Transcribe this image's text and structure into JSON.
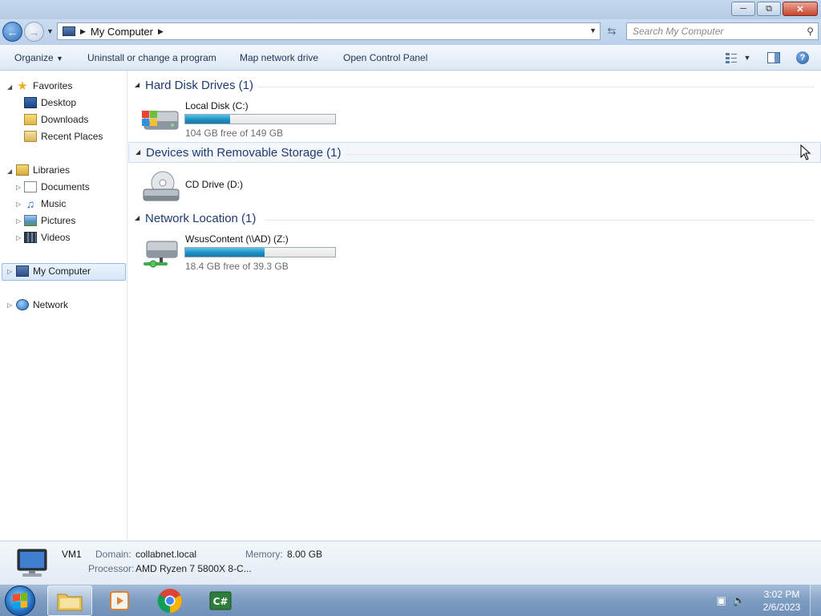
{
  "address": {
    "path": "My Computer",
    "search_placeholder": "Search My Computer"
  },
  "toolbar": {
    "organize": "Organize",
    "uninstall": "Uninstall or change a program",
    "map_drive": "Map network drive",
    "control_panel": "Open Control Panel"
  },
  "nav": {
    "favorites": "Favorites",
    "desktop": "Desktop",
    "downloads": "Downloads",
    "recent": "Recent Places",
    "libraries": "Libraries",
    "documents": "Documents",
    "music": "Music",
    "pictures": "Pictures",
    "videos": "Videos",
    "my_computer": "My Computer",
    "network": "Network"
  },
  "groups": {
    "hdd": {
      "title": "Hard Disk Drives (1)",
      "drives": [
        {
          "name": "Local Disk (C:)",
          "free": "104 GB free of 149 GB",
          "used_fraction": 0.3
        }
      ]
    },
    "removable": {
      "title": "Devices with Removable Storage (1)",
      "drives": [
        {
          "name": "CD Drive (D:)"
        }
      ]
    },
    "network": {
      "title": "Network Location (1)",
      "drives": [
        {
          "name": "WsusContent (\\\\AD) (Z:)",
          "free": "18.4 GB free of 39.3 GB",
          "used_fraction": 0.53
        }
      ]
    }
  },
  "details": {
    "name": "VM1",
    "domain_label": "Domain:",
    "domain": "collabnet.local",
    "memory_label": "Memory:",
    "memory": "8.00 GB",
    "processor_label": "Processor:",
    "processor": "AMD Ryzen 7 5800X 8-C..."
  },
  "taskbar": {
    "time": "3:02 PM",
    "date": "2/6/2023",
    "csharp_label": "C#"
  }
}
